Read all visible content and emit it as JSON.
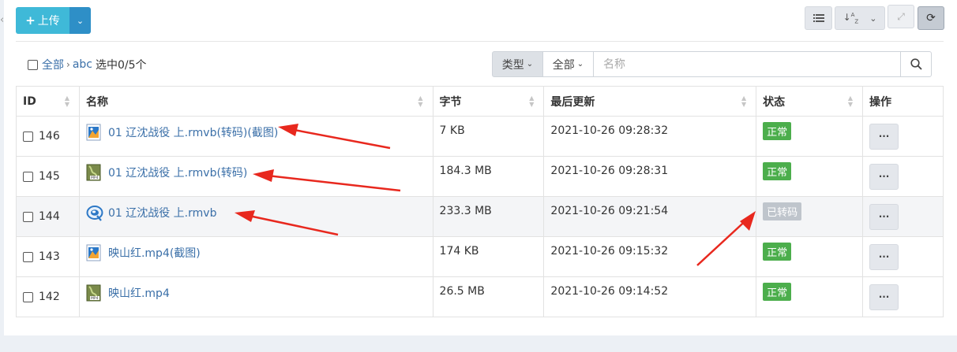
{
  "toolbar": {
    "upload_label": "上传",
    "upload_icon": "plus-icon",
    "list_icon": "list-icon",
    "sort_icon": "sort-alpha-icon",
    "expand_icon": "expand-icon",
    "refresh_icon": "refresh-icon"
  },
  "breadcrumb": {
    "root": "全部",
    "folder": "abc",
    "selection": "选中0/5个"
  },
  "filters": {
    "type_label": "类型",
    "scope_label": "全部",
    "search_placeholder": "名称"
  },
  "table": {
    "columns": [
      "ID",
      "名称",
      "字节",
      "最后更新",
      "状态",
      "操作"
    ],
    "rows": [
      {
        "id": "146",
        "name": "01 辽沈战役 上.rmvb(转码)(截图)",
        "icon": "image-file-icon",
        "size": "7 KB",
        "updated": "2021-10-26 09:28:32",
        "status": "正常",
        "action": "···"
      },
      {
        "id": "145",
        "name": "01 辽沈战役 上.rmvb(转码)",
        "icon": "mp4-file-icon",
        "size": "184.3 MB",
        "updated": "2021-10-26 09:28:31",
        "status": "正常",
        "action": "···"
      },
      {
        "id": "144",
        "name": "01 辽沈战役 上.rmvb",
        "icon": "realplayer-file-icon",
        "size": "233.3 MB",
        "updated": "2021-10-26 09:21:54",
        "status": "已转码",
        "action": "···"
      },
      {
        "id": "143",
        "name": "映山红.mp4(截图)",
        "icon": "image-file-icon",
        "size": "174 KB",
        "updated": "2021-10-26 09:15:32",
        "status": "正常",
        "action": "···"
      },
      {
        "id": "142",
        "name": "映山红.mp4",
        "icon": "mp4-file-icon",
        "size": "26.5 MB",
        "updated": "2021-10-26 09:14:52",
        "status": "正常",
        "action": "···"
      }
    ]
  },
  "colors": {
    "status_ok": "#4cae4c",
    "status_transcoded": "#bfc5cc",
    "annotation_arrow": "#e8281e",
    "upload_button": "#3fb9d8"
  }
}
